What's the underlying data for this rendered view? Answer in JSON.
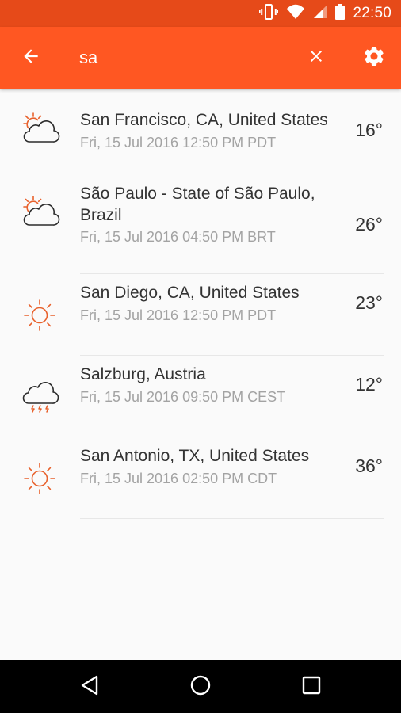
{
  "status_bar": {
    "time": "22:50",
    "icons": [
      "vibrate-icon",
      "wifi-icon",
      "signal-icon",
      "battery-icon"
    ]
  },
  "search": {
    "query": "sa",
    "icons": {
      "back": "arrow-back-icon",
      "clear": "close-icon",
      "settings": "gear-icon"
    }
  },
  "results": [
    {
      "city": "San Francisco, CA, United States",
      "datetime": "Fri, 15 Jul 2016 12:50 PM PDT",
      "temp": "16°",
      "icon": "partly-cloudy-icon"
    },
    {
      "city": "São Paulo - State of São Paulo, Brazil",
      "datetime": "Fri, 15 Jul 2016 04:50 PM BRT",
      "temp": "26°",
      "icon": "partly-cloudy-icon"
    },
    {
      "city": "San Diego, CA, United States",
      "datetime": "Fri, 15 Jul 2016 12:50 PM PDT",
      "temp": "23°",
      "icon": "sun-icon"
    },
    {
      "city": "Salzburg, Austria",
      "datetime": "Fri, 15 Jul 2016 09:50 PM CEST",
      "temp": "12°",
      "icon": "thunderstorm-icon"
    },
    {
      "city": "San Antonio, TX, United States",
      "datetime": "Fri, 15 Jul 2016 02:50 PM CDT",
      "temp": "36°",
      "icon": "sun-icon"
    }
  ],
  "navigation": {
    "icons": [
      "nav-back-icon",
      "nav-home-icon",
      "nav-recents-icon"
    ]
  },
  "colors": {
    "status_bar": "#e64a19",
    "app_bar": "#ff5722",
    "icon_accent": "#e8612c",
    "icon_outline": "#2b2b2b",
    "primary_text": "#333333",
    "secondary_text": "#a3a3a3",
    "divider": "#e7e7e7",
    "nav_bar": "#000000"
  }
}
